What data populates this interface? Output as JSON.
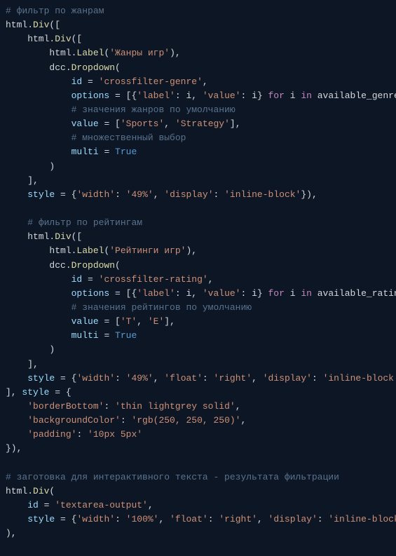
{
  "lines": [
    [
      {
        "cls": "c-comment",
        "t": "# фильтр по жанрам"
      }
    ],
    [
      {
        "cls": "c-default",
        "t": "html."
      },
      {
        "cls": "c-call",
        "t": "Div"
      },
      {
        "cls": "c-default",
        "t": "(["
      }
    ],
    [
      {
        "cls": "c-default",
        "t": "    html."
      },
      {
        "cls": "c-call",
        "t": "Div"
      },
      {
        "cls": "c-default",
        "t": "(["
      }
    ],
    [
      {
        "cls": "c-default",
        "t": "        html."
      },
      {
        "cls": "c-call",
        "t": "Label"
      },
      {
        "cls": "c-default",
        "t": "("
      },
      {
        "cls": "c-string",
        "t": "'Жанры игр'"
      },
      {
        "cls": "c-default",
        "t": "),"
      }
    ],
    [
      {
        "cls": "c-default",
        "t": "        dcc."
      },
      {
        "cls": "c-call",
        "t": "Dropdown"
      },
      {
        "cls": "c-default",
        "t": "("
      }
    ],
    [
      {
        "cls": "c-default",
        "t": "            "
      },
      {
        "cls": "c-param",
        "t": "id"
      },
      {
        "cls": "c-default",
        "t": " = "
      },
      {
        "cls": "c-string",
        "t": "'crossfilter-genre'"
      },
      {
        "cls": "c-default",
        "t": ","
      }
    ],
    [
      {
        "cls": "c-default",
        "t": "            "
      },
      {
        "cls": "c-param",
        "t": "options"
      },
      {
        "cls": "c-default",
        "t": " = [{"
      },
      {
        "cls": "c-string",
        "t": "'label'"
      },
      {
        "cls": "c-default",
        "t": ": i, "
      },
      {
        "cls": "c-string",
        "t": "'value'"
      },
      {
        "cls": "c-default",
        "t": ": i} "
      },
      {
        "cls": "c-keyword",
        "t": "for"
      },
      {
        "cls": "c-default",
        "t": " i "
      },
      {
        "cls": "c-keyword",
        "t": "in"
      },
      {
        "cls": "c-default",
        "t": " available_genre],"
      }
    ],
    [
      {
        "cls": "c-default",
        "t": "            "
      },
      {
        "cls": "c-comment",
        "t": "# значения жанров по умолчанию"
      }
    ],
    [
      {
        "cls": "c-default",
        "t": "            "
      },
      {
        "cls": "c-param",
        "t": "value"
      },
      {
        "cls": "c-default",
        "t": " = ["
      },
      {
        "cls": "c-string",
        "t": "'Sports'"
      },
      {
        "cls": "c-default",
        "t": ", "
      },
      {
        "cls": "c-string",
        "t": "'Strategy'"
      },
      {
        "cls": "c-default",
        "t": "],"
      }
    ],
    [
      {
        "cls": "c-default",
        "t": "            "
      },
      {
        "cls": "c-comment",
        "t": "# множественный выбор"
      }
    ],
    [
      {
        "cls": "c-default",
        "t": "            "
      },
      {
        "cls": "c-param",
        "t": "multi"
      },
      {
        "cls": "c-default",
        "t": " = "
      },
      {
        "cls": "c-const",
        "t": "True"
      }
    ],
    [
      {
        "cls": "c-default",
        "t": "        )"
      }
    ],
    [
      {
        "cls": "c-default",
        "t": "    ],"
      }
    ],
    [
      {
        "cls": "c-default",
        "t": "    "
      },
      {
        "cls": "c-param",
        "t": "style"
      },
      {
        "cls": "c-default",
        "t": " = {"
      },
      {
        "cls": "c-string",
        "t": "'width'"
      },
      {
        "cls": "c-default",
        "t": ": "
      },
      {
        "cls": "c-string",
        "t": "'49%'"
      },
      {
        "cls": "c-default",
        "t": ", "
      },
      {
        "cls": "c-string",
        "t": "'display'"
      },
      {
        "cls": "c-default",
        "t": ": "
      },
      {
        "cls": "c-string",
        "t": "'inline-block'"
      },
      {
        "cls": "c-default",
        "t": "}),"
      }
    ],
    [
      {
        "cls": "c-default",
        "t": ""
      }
    ],
    [
      {
        "cls": "c-default",
        "t": "    "
      },
      {
        "cls": "c-comment",
        "t": "# фильтр по рейтингам"
      }
    ],
    [
      {
        "cls": "c-default",
        "t": "    html."
      },
      {
        "cls": "c-call",
        "t": "Div"
      },
      {
        "cls": "c-default",
        "t": "(["
      }
    ],
    [
      {
        "cls": "c-default",
        "t": "        html."
      },
      {
        "cls": "c-call",
        "t": "Label"
      },
      {
        "cls": "c-default",
        "t": "("
      },
      {
        "cls": "c-string",
        "t": "'Рейтинги игр'"
      },
      {
        "cls": "c-default",
        "t": "),"
      }
    ],
    [
      {
        "cls": "c-default",
        "t": "        dcc."
      },
      {
        "cls": "c-call",
        "t": "Dropdown"
      },
      {
        "cls": "c-default",
        "t": "("
      }
    ],
    [
      {
        "cls": "c-default",
        "t": "            "
      },
      {
        "cls": "c-param",
        "t": "id"
      },
      {
        "cls": "c-default",
        "t": " = "
      },
      {
        "cls": "c-string",
        "t": "'crossfilter-rating'"
      },
      {
        "cls": "c-default",
        "t": ","
      }
    ],
    [
      {
        "cls": "c-default",
        "t": "            "
      },
      {
        "cls": "c-param",
        "t": "options"
      },
      {
        "cls": "c-default",
        "t": " = [{"
      },
      {
        "cls": "c-string",
        "t": "'label'"
      },
      {
        "cls": "c-default",
        "t": ": i, "
      },
      {
        "cls": "c-string",
        "t": "'value'"
      },
      {
        "cls": "c-default",
        "t": ": i} "
      },
      {
        "cls": "c-keyword",
        "t": "for"
      },
      {
        "cls": "c-default",
        "t": " i "
      },
      {
        "cls": "c-keyword",
        "t": "in"
      },
      {
        "cls": "c-default",
        "t": " available_rating],"
      }
    ],
    [
      {
        "cls": "c-default",
        "t": "            "
      },
      {
        "cls": "c-comment",
        "t": "# значения рейтингов по умолчанию"
      }
    ],
    [
      {
        "cls": "c-default",
        "t": "            "
      },
      {
        "cls": "c-param",
        "t": "value"
      },
      {
        "cls": "c-default",
        "t": " = ["
      },
      {
        "cls": "c-string",
        "t": "'T'"
      },
      {
        "cls": "c-default",
        "t": ", "
      },
      {
        "cls": "c-string",
        "t": "'E'"
      },
      {
        "cls": "c-default",
        "t": "],"
      }
    ],
    [
      {
        "cls": "c-default",
        "t": "            "
      },
      {
        "cls": "c-param",
        "t": "multi"
      },
      {
        "cls": "c-default",
        "t": " = "
      },
      {
        "cls": "c-const",
        "t": "True"
      }
    ],
    [
      {
        "cls": "c-default",
        "t": "        )"
      }
    ],
    [
      {
        "cls": "c-default",
        "t": "    ],"
      }
    ],
    [
      {
        "cls": "c-default",
        "t": "    "
      },
      {
        "cls": "c-param",
        "t": "style"
      },
      {
        "cls": "c-default",
        "t": " = {"
      },
      {
        "cls": "c-string",
        "t": "'width'"
      },
      {
        "cls": "c-default",
        "t": ": "
      },
      {
        "cls": "c-string",
        "t": "'49%'"
      },
      {
        "cls": "c-default",
        "t": ", "
      },
      {
        "cls": "c-string",
        "t": "'float'"
      },
      {
        "cls": "c-default",
        "t": ": "
      },
      {
        "cls": "c-string",
        "t": "'right'"
      },
      {
        "cls": "c-default",
        "t": ", "
      },
      {
        "cls": "c-string",
        "t": "'display'"
      },
      {
        "cls": "c-default",
        "t": ": "
      },
      {
        "cls": "c-string",
        "t": "'inline-block'"
      },
      {
        "cls": "c-default",
        "t": "})"
      }
    ],
    [
      {
        "cls": "c-default",
        "t": "], "
      },
      {
        "cls": "c-param",
        "t": "style"
      },
      {
        "cls": "c-default",
        "t": " = {"
      }
    ],
    [
      {
        "cls": "c-default",
        "t": "    "
      },
      {
        "cls": "c-string",
        "t": "'borderBottom'"
      },
      {
        "cls": "c-default",
        "t": ": "
      },
      {
        "cls": "c-string",
        "t": "'thin lightgrey solid'"
      },
      {
        "cls": "c-default",
        "t": ","
      }
    ],
    [
      {
        "cls": "c-default",
        "t": "    "
      },
      {
        "cls": "c-string",
        "t": "'backgroundColor'"
      },
      {
        "cls": "c-default",
        "t": ": "
      },
      {
        "cls": "c-string",
        "t": "'rgb(250, 250, 250)'"
      },
      {
        "cls": "c-default",
        "t": ","
      }
    ],
    [
      {
        "cls": "c-default",
        "t": "    "
      },
      {
        "cls": "c-string",
        "t": "'padding'"
      },
      {
        "cls": "c-default",
        "t": ": "
      },
      {
        "cls": "c-string",
        "t": "'10px 5px'"
      }
    ],
    [
      {
        "cls": "c-default",
        "t": "}),"
      }
    ],
    [
      {
        "cls": "c-default",
        "t": ""
      }
    ],
    [
      {
        "cls": "c-comment",
        "t": "# заготовка для интерактивного текста - результата фильтрации"
      }
    ],
    [
      {
        "cls": "c-default",
        "t": "html."
      },
      {
        "cls": "c-call",
        "t": "Div"
      },
      {
        "cls": "c-default",
        "t": "("
      }
    ],
    [
      {
        "cls": "c-default",
        "t": "    "
      },
      {
        "cls": "c-param",
        "t": "id"
      },
      {
        "cls": "c-default",
        "t": " = "
      },
      {
        "cls": "c-string",
        "t": "'textarea-output'"
      },
      {
        "cls": "c-default",
        "t": ","
      }
    ],
    [
      {
        "cls": "c-default",
        "t": "    "
      },
      {
        "cls": "c-param",
        "t": "style"
      },
      {
        "cls": "c-default",
        "t": " = {"
      },
      {
        "cls": "c-string",
        "t": "'width'"
      },
      {
        "cls": "c-default",
        "t": ": "
      },
      {
        "cls": "c-string",
        "t": "'100%'"
      },
      {
        "cls": "c-default",
        "t": ", "
      },
      {
        "cls": "c-string",
        "t": "'float'"
      },
      {
        "cls": "c-default",
        "t": ": "
      },
      {
        "cls": "c-string",
        "t": "'right'"
      },
      {
        "cls": "c-default",
        "t": ", "
      },
      {
        "cls": "c-string",
        "t": "'display'"
      },
      {
        "cls": "c-default",
        "t": ": "
      },
      {
        "cls": "c-string",
        "t": "'inline-block'"
      },
      {
        "cls": "c-default",
        "t": "}"
      }
    ],
    [
      {
        "cls": "c-default",
        "t": "),"
      }
    ]
  ]
}
